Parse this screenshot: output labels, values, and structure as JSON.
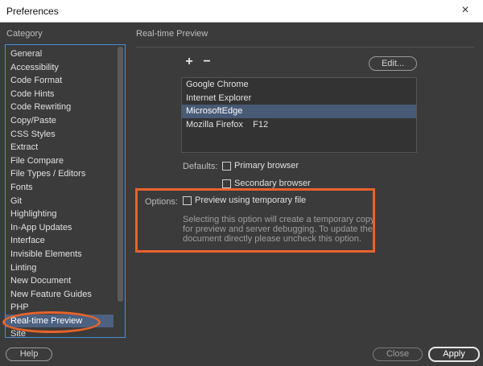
{
  "window": {
    "title": "Preferences",
    "close_glyph": "×"
  },
  "sidebar": {
    "heading": "Category",
    "items": [
      "General",
      "Accessibility",
      "Code Format",
      "Code Hints",
      "Code Rewriting",
      "Copy/Paste",
      "CSS Styles",
      "Extract",
      "File Compare",
      "File Types / Editors",
      "Fonts",
      "Git",
      "Highlighting",
      "In-App Updates",
      "Interface",
      "Invisible Elements",
      "Linting",
      "New Document",
      "New Feature Guides",
      "PHP",
      "Real-time Preview",
      "Site"
    ],
    "selected": "Real-time Preview"
  },
  "panel": {
    "title": "Real-time Preview",
    "add_label": "+",
    "remove_label": "−",
    "edit_label": "Edit...",
    "browsers": [
      "Google Chrome",
      "Internet Explorer",
      "MicrosoftEdge",
      "Mozilla Firefox    F12"
    ],
    "selected_browser": "MicrosoftEdge",
    "defaults_label": "Defaults:",
    "primary_label": "Primary browser",
    "secondary_label": "Secondary browser",
    "options_label": "Options:",
    "preview_temp_label": "Preview using temporary file",
    "description": "Selecting this option will create a temporary copy for preview and server debugging. To update the document directly please uncheck this option."
  },
  "footer": {
    "help_label": "Help",
    "close_label": "Close",
    "apply_label": "Apply"
  },
  "colors": {
    "annotation": "#e8632a",
    "selection": "#4d6180",
    "focus_border": "#4b8dd8"
  }
}
